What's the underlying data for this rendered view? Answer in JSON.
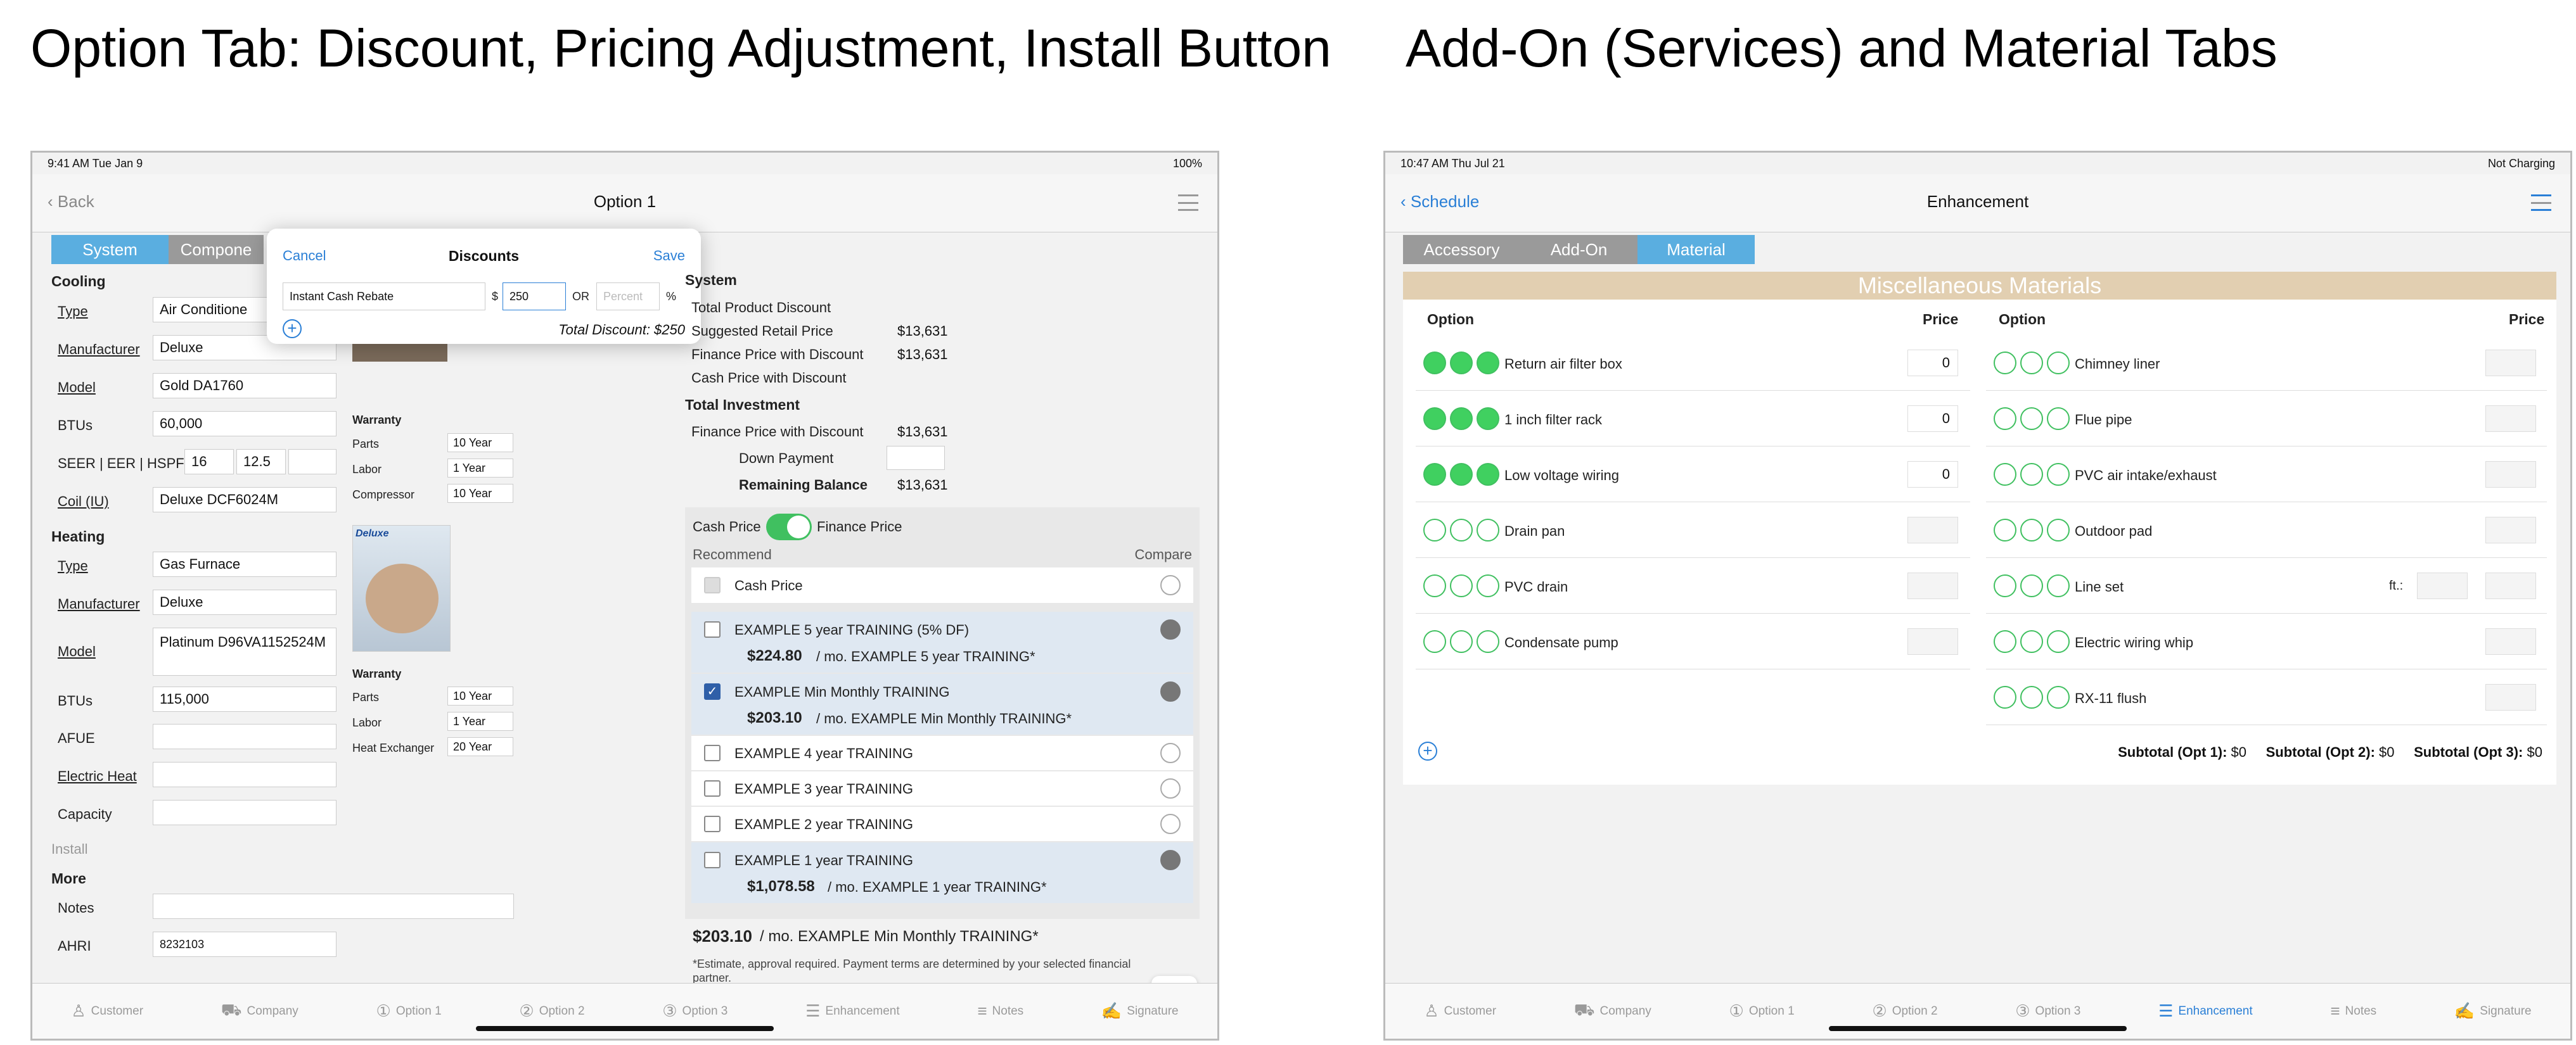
{
  "titles": {
    "left": "Option Tab: Discount, Pricing Adjustment, Install Button",
    "right": "Add-On (Services) and Material Tabs"
  },
  "colors": {
    "accent": "#5aaee0",
    "gray_tab": "#9a9a9a",
    "green": "#40d060",
    "banner": "#e2cfb1",
    "link": "#2a7fd6"
  },
  "left": {
    "status": {
      "time": "9:41 AM  Tue Jan 9",
      "battery": "100%"
    },
    "nav": {
      "back": "Back",
      "title": "Option 1"
    },
    "tabs": [
      "System",
      "Compone"
    ],
    "cooling": {
      "heading": "Cooling",
      "type_label": "Type",
      "type": "Air Conditione",
      "mfr_label": "Manufacturer",
      "mfr": "Deluxe",
      "model_label": "Model",
      "model": "Gold DA1760",
      "btus_label": "BTUs",
      "btus": "60,000",
      "seer_label": "SEER | EER | HSPF",
      "seer": "16",
      "eer": "12.5",
      "coil_label": "Coil (IU)",
      "coil": "Deluxe DCF6024M"
    },
    "heating": {
      "heading": "Heating",
      "type_label": "Type",
      "type": "Gas Furnace",
      "mfr_label": "Manufacturer",
      "mfr": "Deluxe",
      "model_label": "Model",
      "model": "Platinum D96VA1152524M",
      "btus_label": "BTUs",
      "btus": "115,000",
      "afue_label": "AFUE",
      "eheat_label": "Electric Heat",
      "cap_label": "Capacity"
    },
    "install": "Install",
    "more": {
      "heading": "More",
      "notes_label": "Notes",
      "ahri_label": "AHRI",
      "ahri": "8232103"
    },
    "warranty1": {
      "heading": "Warranty",
      "rows": [
        [
          "Parts",
          "10 Year"
        ],
        [
          "Labor",
          "1 Year"
        ],
        [
          "Compressor",
          "10 Year"
        ]
      ]
    },
    "warranty2": {
      "heading": "Warranty",
      "rows": [
        [
          "Parts",
          "10 Year"
        ],
        [
          "Labor",
          "1 Year"
        ],
        [
          "Heat Exchanger",
          "20 Year"
        ]
      ]
    },
    "deluxe_logo": "Deluxe",
    "popover": {
      "cancel": "Cancel",
      "title": "Discounts",
      "save": "Save",
      "name": "Instant Cash Rebate",
      "dollar": "$",
      "amount": "250",
      "or": "OR",
      "percent_placeholder": "Percent",
      "percent_sign": "%",
      "total": "Total Discount: $250"
    },
    "pricing": {
      "system": "System",
      "total_disc": "Total Product Discount",
      "srp": "Suggested Retail Price",
      "srp_v": "$13,631",
      "fin_disc": "Finance Price with Discount",
      "fin_disc_v": "$13,631",
      "cash_disc": "Cash Price with Discount",
      "total_inv": "Total Investment",
      "fin2": "Finance Price with Discount",
      "fin2_v": "$13,631",
      "down": "Down Payment",
      "remain": "Remaining Balance",
      "remain_v": "$13,631"
    },
    "toggle": {
      "cash": "Cash Price",
      "finance": "Finance Price"
    },
    "recommend": "Recommend",
    "compare": "Compare",
    "plans": [
      {
        "name": "Cash Price",
        "sub_amt": "",
        "sub": ""
      },
      {
        "name": "EXAMPLE 5 year TRAINING (5% DF)",
        "sub_amt": "$224.80",
        "sub": "/ mo. EXAMPLE 5 year TRAINING*"
      },
      {
        "name": "EXAMPLE Min Monthly TRAINING",
        "sub_amt": "$203.10",
        "sub": "/ mo. EXAMPLE Min Monthly TRAINING*"
      },
      {
        "name": "EXAMPLE 4 year TRAINING",
        "sub_amt": "",
        "sub": ""
      },
      {
        "name": "EXAMPLE 3 year TRAINING",
        "sub_amt": "",
        "sub": ""
      },
      {
        "name": "EXAMPLE 2 year TRAINING",
        "sub_amt": "",
        "sub": ""
      },
      {
        "name": "EXAMPLE 1 year TRAINING",
        "sub_amt": "$1,078.58",
        "sub": "/ mo. EXAMPLE 1 year TRAINING*"
      }
    ],
    "summary_amt": "$203.10",
    "summary": "/ mo. EXAMPLE Min Monthly TRAINING*",
    "disclaimer": "*Estimate, approval required. Payment terms are determined by your selected financial partner."
  },
  "right": {
    "status": {
      "time": "10:47 AM  Thu Jul 21",
      "battery": "Not Charging"
    },
    "nav": {
      "back": "Schedule",
      "title": "Enhancement"
    },
    "tabs": [
      "Accessory",
      "Add-On",
      "Material"
    ],
    "banner": "Miscellaneous Materials",
    "col_option": "Option",
    "col_price": "Price",
    "left_items": [
      {
        "name": "Return air filter box",
        "on": true,
        "price": "0"
      },
      {
        "name": "1 inch filter rack",
        "on": true,
        "price": "0"
      },
      {
        "name": "Low voltage wiring",
        "on": true,
        "price": "0"
      },
      {
        "name": "Drain pan",
        "on": false,
        "price": ""
      },
      {
        "name": "PVC drain",
        "on": false,
        "price": ""
      },
      {
        "name": "Condensate pump",
        "on": false,
        "price": ""
      }
    ],
    "right_items": [
      {
        "name": "Chimney liner"
      },
      {
        "name": "Flue pipe"
      },
      {
        "name": "PVC air intake/exhaust"
      },
      {
        "name": "Outdoor pad"
      },
      {
        "name": "Line set",
        "ft": "ft.:"
      },
      {
        "name": "Electric wiring whip"
      },
      {
        "name": "RX-11 flush"
      }
    ],
    "sub1_l": "Subtotal (Opt 1):",
    "sub1": "$0",
    "sub2_l": "Subtotal (Opt 2):",
    "sub2": "$0",
    "sub3_l": "Subtotal (Opt 3):",
    "sub3": "$0"
  },
  "tabbar": [
    "Customer",
    "Company",
    "Option 1",
    "Option 2",
    "Option 3",
    "Enhancement",
    "Notes",
    "Signature"
  ]
}
